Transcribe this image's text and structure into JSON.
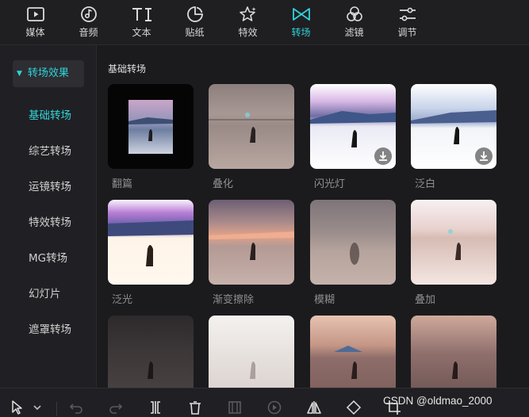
{
  "top_tabs": [
    {
      "label": "媒体",
      "icon": "media-icon"
    },
    {
      "label": "音频",
      "icon": "audio-icon"
    },
    {
      "label": "文本",
      "icon": "text-icon"
    },
    {
      "label": "贴纸",
      "icon": "sticker-icon"
    },
    {
      "label": "特效",
      "icon": "effects-icon"
    },
    {
      "label": "转场",
      "icon": "transition-icon",
      "active": true
    },
    {
      "label": "滤镜",
      "icon": "filter-icon"
    },
    {
      "label": "调节",
      "icon": "adjust-icon"
    }
  ],
  "sidebar": {
    "header": "转场效果",
    "items": [
      {
        "label": "基础转场",
        "active": true
      },
      {
        "label": "综艺转场"
      },
      {
        "label": "运镜转场"
      },
      {
        "label": "特效转场"
      },
      {
        "label": "MG转场"
      },
      {
        "label": "幻灯片"
      },
      {
        "label": "遮罩转场"
      }
    ]
  },
  "main": {
    "section_title": "基础转场",
    "cards": [
      {
        "label": "翻篇"
      },
      {
        "label": "叠化"
      },
      {
        "label": "闪光灯",
        "download": true
      },
      {
        "label": "泛白",
        "download": true
      },
      {
        "label": "泛光"
      },
      {
        "label": "渐变擦除"
      },
      {
        "label": "模糊"
      },
      {
        "label": "叠加"
      },
      {
        "label": ""
      },
      {
        "label": ""
      },
      {
        "label": ""
      },
      {
        "label": ""
      }
    ]
  },
  "bottom_toolbar": {
    "tools": [
      "select-cursor-icon",
      "dropdown-chevron-icon",
      "undo-icon",
      "redo-icon",
      "split-icon",
      "delete-icon",
      "freeze-icon",
      "play-reverse-icon",
      "mirror-icon",
      "rotate-icon",
      "crop-icon"
    ],
    "watermark": "CSDN @oldmao_2000"
  },
  "colors": {
    "accent": "#2fd3d9",
    "background": "#1b1b1e"
  }
}
